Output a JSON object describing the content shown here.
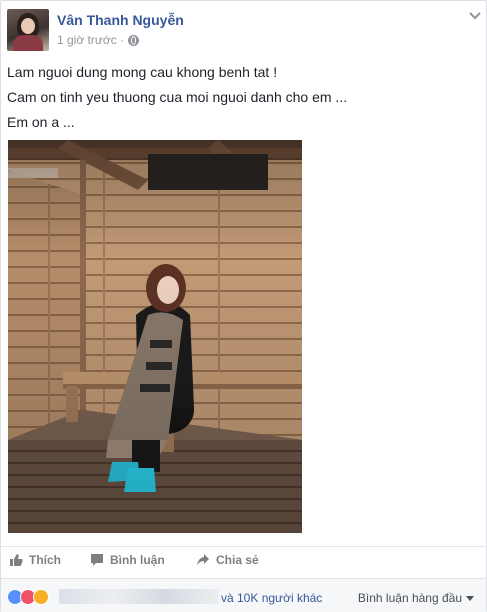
{
  "post": {
    "author": "Vân Thanh Nguyễn",
    "time": "1 giờ trước ·",
    "privacy_icon": "globe-icon",
    "menu_icon": "chevron-down-icon",
    "lines": [
      "Lam nguoi dung mong cau khong benh tat !",
      "Cam on tinh yeu thuong cua moi nguoi danh cho em ...",
      "Em on a ..."
    ]
  },
  "actions": {
    "like": "Thích",
    "comment": "Bình luận",
    "share": "Chia sẻ"
  },
  "reactions": {
    "icons": [
      "like-icon",
      "love-icon",
      "sad-icon"
    ],
    "others": "và 10K người khác",
    "sort_label": "Bình luận hàng đầu"
  },
  "colors": {
    "link": "#365899",
    "like": "#5890ff",
    "love": "#f25268",
    "sad": "#f7b125"
  }
}
